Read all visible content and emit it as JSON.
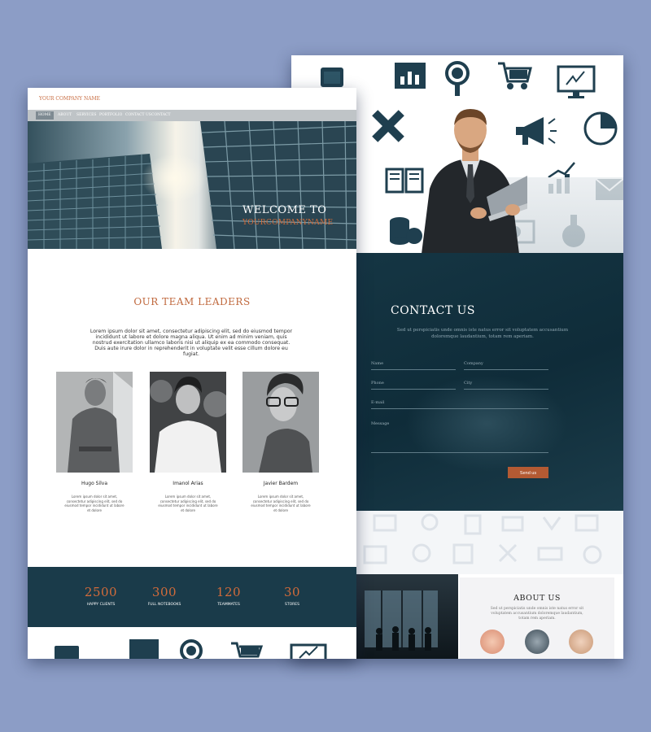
{
  "back_page": {
    "contact": {
      "title": "CONTACT US",
      "subtitle": "Sed ut perspiciatis unde omnis iste natus error sit voluptatem accusantium doloremque laudantium, totam rem aperiam.",
      "fields": {
        "name": "Name",
        "company": "Company",
        "phone": "Phone",
        "city": "City",
        "email": "E-mail",
        "message": "Message"
      },
      "send_label": "Send us"
    },
    "about": {
      "title": "ABOUT US",
      "subtitle": "Sed ut perspiciatis unde omnis iste natus error sit voluptatem accusantium doloremque laudantium, totam rem aperiam."
    }
  },
  "front_page": {
    "logo": "YOUR COMPANY NAME",
    "nav": [
      "HOME",
      "ABOUT",
      "SERVICES",
      "PORTFOLIO",
      "CONTACT US",
      "CONTACT"
    ],
    "hero": {
      "title": "WELCOME TO",
      "subtitle": "YOURCOMPANYNAME"
    },
    "team": {
      "title": "OUR TEAM LEADERS",
      "description": "Lorem ipsum dolor sit amet, consectetur adipiscing elit, sed do eiusmod tempor incididunt ut labore et dolore magna aliqua. Ut enim ad minim veniam, quis nostrud exercitation ullamco laboris nisi ut aliquip ex ea commodo consequat. Duis aute irure dolor in reprehenderit in voluptate velit esse cillum dolore eu fugiat.",
      "members": [
        {
          "name": "Hugo Silva",
          "desc": "Lorem ipsum dolor sit amet, consectetur adipiscing elit, sed do eiusmod tempor incididunt ut labore et dolore"
        },
        {
          "name": "Imanol Arias",
          "desc": "Lorem ipsum dolor sit amet, consectetur adipiscing elit, sed do eiusmod tempor incididunt ut labore et dolore"
        },
        {
          "name": "Javier Bardem",
          "desc": "Lorem ipsum dolor sit amet, consectetur adipiscing elit, sed do eiusmod tempor incididunt ut labore et dolore"
        }
      ]
    },
    "stats": [
      {
        "value": "2500",
        "label": "HAPPY CLIENTS"
      },
      {
        "value": "300",
        "label": "FULL NOTEBOOKS"
      },
      {
        "value": "120",
        "label": "TEAMMATES"
      },
      {
        "value": "30",
        "label": "STORES"
      }
    ]
  },
  "colors": {
    "accent": "#c0693e",
    "dark_teal": "#1a3b4a",
    "background": "#8c9dc6"
  }
}
